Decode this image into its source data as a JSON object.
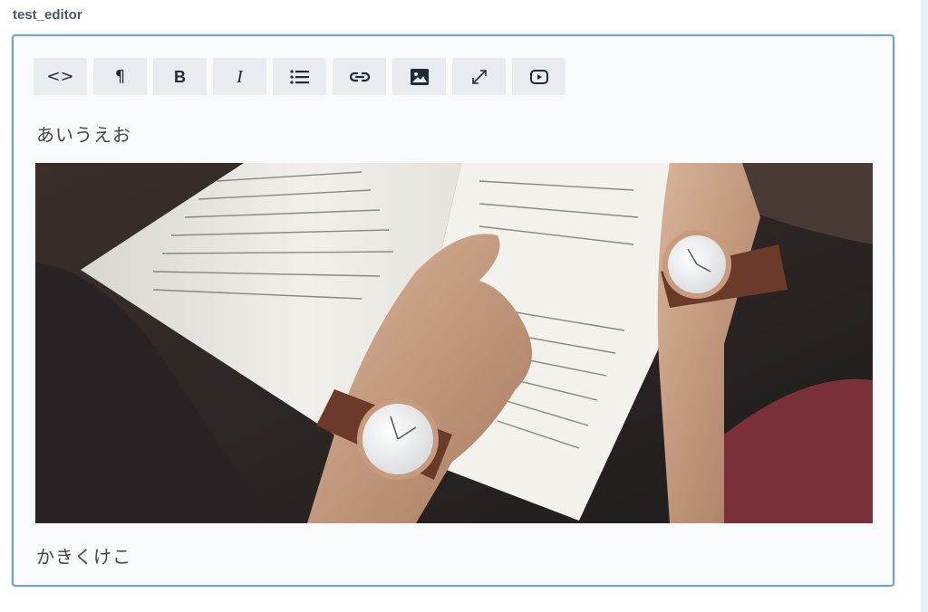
{
  "field": {
    "label": "test_editor"
  },
  "toolbar": {
    "buttons": [
      {
        "name": "source-code",
        "icon": "code-icon",
        "glyph": "<>"
      },
      {
        "name": "paragraph",
        "icon": "pilcrow-icon",
        "glyph": "¶"
      },
      {
        "name": "bold",
        "icon": "bold-icon",
        "glyph": "B"
      },
      {
        "name": "italic",
        "icon": "italic-icon",
        "glyph": "I"
      },
      {
        "name": "list",
        "icon": "list-icon",
        "glyph": ""
      },
      {
        "name": "link",
        "icon": "link-icon",
        "glyph": ""
      },
      {
        "name": "image",
        "icon": "image-icon",
        "glyph": ""
      },
      {
        "name": "fullscreen",
        "icon": "expand-icon",
        "glyph": ""
      },
      {
        "name": "video",
        "icon": "video-icon",
        "glyph": ""
      }
    ]
  },
  "content": {
    "paragraph1": "あいうえお",
    "paragraph2": "かきくけこ",
    "image": {
      "subject": "open-book-with-two-wristwatches-photo"
    }
  },
  "colors": {
    "editor_border": "#6fa0d8",
    "editor_background": "#f8fafc",
    "button_background": "#e8ebef",
    "text": "#3f4650"
  }
}
